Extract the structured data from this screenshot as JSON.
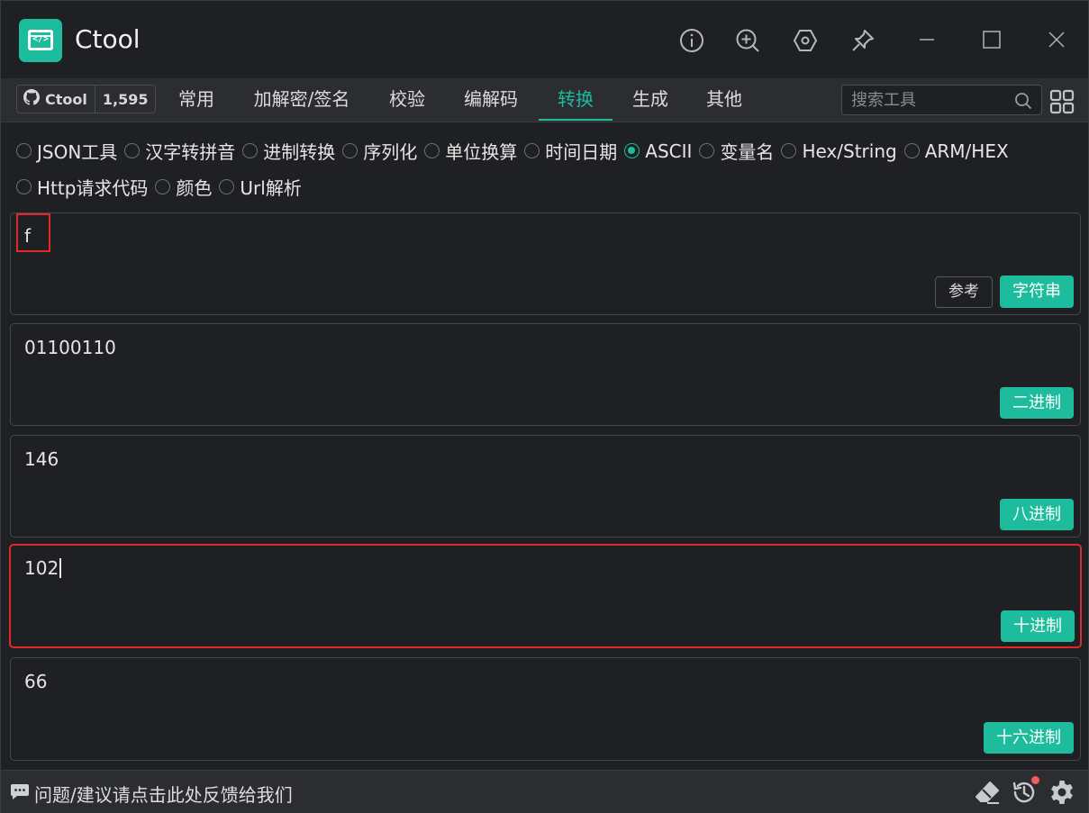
{
  "app": {
    "title": "Ctool"
  },
  "github": {
    "label": "Ctool",
    "stars": "1,595"
  },
  "nav": {
    "tabs": [
      {
        "label": "常用"
      },
      {
        "label": "加解密/签名"
      },
      {
        "label": "校验"
      },
      {
        "label": "编解码"
      },
      {
        "label": "转换",
        "active": true
      },
      {
        "label": "生成"
      },
      {
        "label": "其他"
      }
    ]
  },
  "search": {
    "placeholder": "搜索工具",
    "value": ""
  },
  "tools": {
    "row1": [
      {
        "label": "JSON工具"
      },
      {
        "label": "汉字转拼音"
      },
      {
        "label": "进制转换"
      },
      {
        "label": "序列化"
      },
      {
        "label": "单位换算"
      },
      {
        "label": "时间日期"
      },
      {
        "label": "ASCII",
        "checked": true
      },
      {
        "label": "变量名"
      },
      {
        "label": "Hex/String"
      },
      {
        "label": "ARM/HEX"
      }
    ],
    "row2": [
      {
        "label": "Http请求代码"
      },
      {
        "label": "颜色"
      },
      {
        "label": "Url解析"
      }
    ]
  },
  "panels": {
    "string": {
      "value": "f",
      "reference_label": "参考",
      "type_label": "字符串"
    },
    "binary": {
      "value": "01100110",
      "type_label": "二进制"
    },
    "octal": {
      "value": "146",
      "type_label": "八进制"
    },
    "decimal": {
      "value": "102",
      "type_label": "十进制"
    },
    "hex": {
      "value": "66",
      "type_label": "十六进制"
    }
  },
  "footer": {
    "feedback": "问题/建议请点击此处反馈给我们"
  },
  "colors": {
    "accent": "#1cbc9c",
    "highlight": "#e02a2a",
    "background": "#1f2023",
    "bar": "#2b2d31"
  }
}
